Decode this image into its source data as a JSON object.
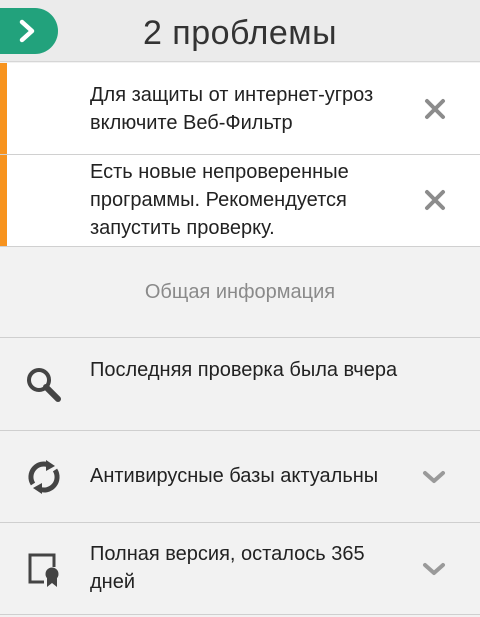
{
  "header": {
    "title": "2 проблемы",
    "back_icon": "chevron-right-icon",
    "accent_color": "#22a27c"
  },
  "alerts": [
    {
      "text": "Для защиты от интернет-угроз включите Веб-Фильтр",
      "dismiss_icon": "close-icon"
    },
    {
      "text": "Есть новые непроверенные программы. Рекомендуется запустить проверку.",
      "dismiss_icon": "close-icon"
    }
  ],
  "alert_stripe_color": "#f7931e",
  "section": {
    "title": "Общая информация"
  },
  "rows": [
    {
      "label": "Последняя проверка была вчера",
      "icon": "search-icon"
    },
    {
      "label": "Антивирусные базы актуальны",
      "icon": "refresh-icon",
      "expand_icon": "chevron-down-icon"
    },
    {
      "label": "Полная версия, осталось 365 дней",
      "icon": "license-certificate-icon",
      "expand_icon": "chevron-down-icon"
    }
  ]
}
